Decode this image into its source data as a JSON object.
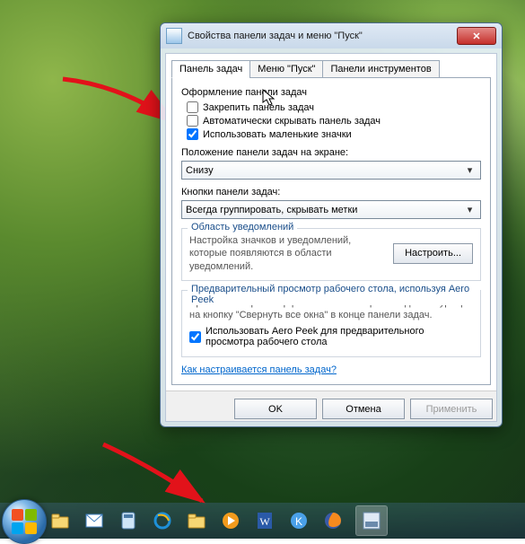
{
  "window": {
    "title": "Свойства панели задач и меню \"Пуск\"",
    "close": "✕"
  },
  "tabs": {
    "taskbar": "Панель задач",
    "start": "Меню \"Пуск\"",
    "toolbars": "Панели инструментов"
  },
  "appearance": {
    "title": "Оформление панели задач",
    "lock": "Закрепить панель задач",
    "autohide": "Автоматически скрывать панель задач",
    "smallicons": "Использовать маленькие значки"
  },
  "position": {
    "label": "Положение панели задач на экране:",
    "value": "Снизу"
  },
  "buttons": {
    "label": "Кнопки панели задач:",
    "value": "Всегда группировать, скрывать метки"
  },
  "notify": {
    "title": "Область уведомлений",
    "desc": "Настройка значков и уведомлений, которые появляются в области уведомлений.",
    "btn": "Настроить..."
  },
  "aero": {
    "title": "Предварительный просмотр рабочего стола, используя Aero Peek",
    "desc": "Временный просмотр рабочего стола при наведении курсора на кнопку \"Свернуть все окна\" в конце панели задач.",
    "chk": "Использовать Aero Peek для предварительного просмотра рабочего стола"
  },
  "link": "Как настраивается панель задач?",
  "dlg": {
    "ok": "OK",
    "cancel": "Отмена",
    "apply": "Применить"
  },
  "taskbar_icons": [
    "explorer",
    "mail",
    "calc",
    "ie",
    "folder",
    "wmp",
    "word",
    "browser-k",
    "firefox",
    "totalcmd"
  ]
}
